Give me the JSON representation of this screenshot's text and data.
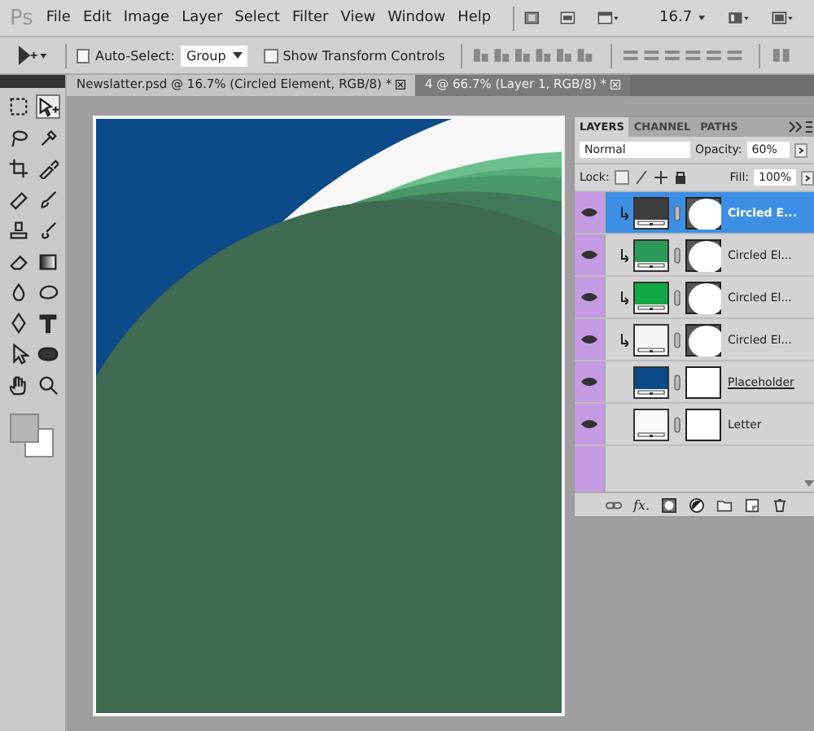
{
  "app_logo": "Ps",
  "menu": [
    "File",
    "Edit",
    "Image",
    "Layer",
    "Select",
    "Filter",
    "View",
    "Window",
    "Help"
  ],
  "zoom": "16.7",
  "options_bar": {
    "auto_select": {
      "label": "Auto-Select:",
      "checked": false
    },
    "auto_select_target": "Group",
    "show_transform": {
      "label": "Show Transform Controls",
      "checked": false
    }
  },
  "document_tabs": [
    {
      "title": "Newslatter.psd @ 16.7% (Circled Element, RGB/8) *",
      "selected": true
    },
    {
      "title": "4 @ 66.7% (Layer 1, RGB/8) *",
      "selected": false
    }
  ],
  "tools": [
    {
      "kind": "marquee",
      "selected": false
    },
    {
      "kind": "move",
      "selected": true
    },
    {
      "kind": "lasso",
      "selected": false
    },
    {
      "kind": "quick-select",
      "selected": false
    },
    {
      "kind": "crop",
      "selected": false
    },
    {
      "kind": "eyedropper",
      "selected": false
    },
    {
      "kind": "healing",
      "selected": false
    },
    {
      "kind": "brush",
      "selected": false
    },
    {
      "kind": "stamp",
      "selected": false
    },
    {
      "kind": "history",
      "selected": false
    },
    {
      "kind": "eraser",
      "selected": false
    },
    {
      "kind": "gradient",
      "selected": false
    },
    {
      "kind": "blur",
      "selected": false
    },
    {
      "kind": "dodge",
      "selected": false
    },
    {
      "kind": "pen",
      "selected": false
    },
    {
      "kind": "type",
      "selected": false
    },
    {
      "kind": "path-select",
      "selected": false
    },
    {
      "kind": "shape",
      "selected": false
    },
    {
      "kind": "hand",
      "selected": false
    },
    {
      "kind": "zoom",
      "selected": false
    }
  ],
  "layers_panel": {
    "tabs": [
      {
        "label": "LAYERS",
        "selected": true
      },
      {
        "label": "CHANNEL",
        "selected": false
      },
      {
        "label": "PATHS",
        "selected": false
      }
    ],
    "blend_mode": "Normal",
    "opacity_label": "Opacity:",
    "opacity": "60%",
    "lock_label": "Lock:",
    "fill_label": "Fill:",
    "fill": "100%",
    "layers": [
      {
        "name": "Circled E...",
        "color": "#3d3d3d",
        "clipped": true,
        "circle_mask": true,
        "selected": true,
        "visible": true,
        "underlined": false
      },
      {
        "name": "Circled El...",
        "color": "#2e9a5a",
        "clipped": true,
        "circle_mask": true,
        "selected": false,
        "visible": true,
        "underlined": false
      },
      {
        "name": "Circled El...",
        "color": "#10a845",
        "clipped": true,
        "circle_mask": true,
        "selected": false,
        "visible": true,
        "underlined": false
      },
      {
        "name": "Circled El...",
        "color": "#f4f4f4",
        "clipped": true,
        "circle_mask": true,
        "selected": false,
        "visible": true,
        "underlined": false
      },
      {
        "name": "Placeholder",
        "color": "#0d4a8a",
        "clipped": false,
        "circle_mask": false,
        "selected": false,
        "visible": true,
        "underlined": true
      },
      {
        "name": "Letter",
        "color": "#f8f8f8",
        "clipped": false,
        "circle_mask": false,
        "selected": false,
        "visible": true,
        "underlined": false
      }
    ],
    "footer_fx": "fx."
  }
}
